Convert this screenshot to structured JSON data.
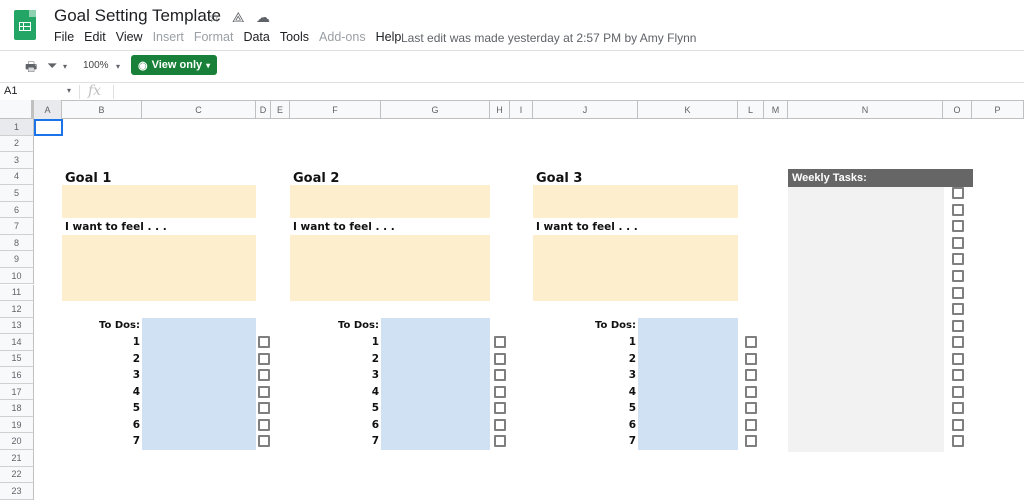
{
  "app": {
    "title": "Goal Setting Template",
    "title_icons": [
      "star-icon",
      "move-to-drive-icon",
      "cloud-status-icon"
    ],
    "menu": [
      {
        "label": "File",
        "enabled": true
      },
      {
        "label": "Edit",
        "enabled": true
      },
      {
        "label": "View",
        "enabled": true
      },
      {
        "label": "Insert",
        "enabled": false
      },
      {
        "label": "Format",
        "enabled": false
      },
      {
        "label": "Data",
        "enabled": true
      },
      {
        "label": "Tools",
        "enabled": true
      },
      {
        "label": "Add-ons",
        "enabled": false
      },
      {
        "label": "Help",
        "enabled": true
      }
    ],
    "last_edit": "Last edit was made yesterday at 2:57 PM by Amy Flynn"
  },
  "toolbar": {
    "zoom": "100%",
    "view_only_label": "View only",
    "accent_color": "#188038"
  },
  "formula_bar": {
    "name_box": "A1",
    "fx_label": "fx",
    "value": ""
  },
  "grid": {
    "columns": [
      "A",
      "B",
      "C",
      "D",
      "E",
      "F",
      "G",
      "H",
      "I",
      "J",
      "K",
      "L",
      "M",
      "N",
      "O",
      "P"
    ],
    "rows": [
      "1",
      "2",
      "3",
      "4",
      "5",
      "6",
      "7",
      "8",
      "9",
      "10",
      "11",
      "12",
      "13",
      "14",
      "15",
      "16",
      "17",
      "18",
      "19",
      "20",
      "21",
      "22",
      "23"
    ],
    "selected_cell": "A1"
  },
  "goals": [
    {
      "title": "Goal 1",
      "feel_label": "I want to feel . . .",
      "todo_label": "To Dos:",
      "todo_numbers": [
        "1",
        "2",
        "3",
        "4",
        "5",
        "6",
        "7"
      ],
      "checked": [
        false,
        false,
        false,
        false,
        false,
        false,
        false
      ]
    },
    {
      "title": "Goal 2",
      "feel_label": "I want to feel . . .",
      "todo_label": "To Dos:",
      "todo_numbers": [
        "1",
        "2",
        "3",
        "4",
        "5",
        "6",
        "7"
      ],
      "checked": [
        false,
        false,
        false,
        false,
        false,
        false,
        false
      ]
    },
    {
      "title": "Goal 3",
      "feel_label": "I want to feel . . .",
      "todo_label": "To Dos:",
      "todo_numbers": [
        "1",
        "2",
        "3",
        "4",
        "5",
        "6",
        "7"
      ],
      "checked": [
        false,
        false,
        false,
        false,
        false,
        false,
        false
      ]
    }
  ],
  "weekly": {
    "title": "Weekly Tasks:",
    "checked": [
      false,
      false,
      false,
      false,
      false,
      false,
      false,
      false,
      false,
      false,
      false,
      false,
      false,
      false,
      false,
      false
    ]
  },
  "colors": {
    "goal_fill": "#fdefcd",
    "todo_fill": "#cfe1f2",
    "weekly_header": "#666666",
    "weekly_fill": "#f2f2f2"
  }
}
